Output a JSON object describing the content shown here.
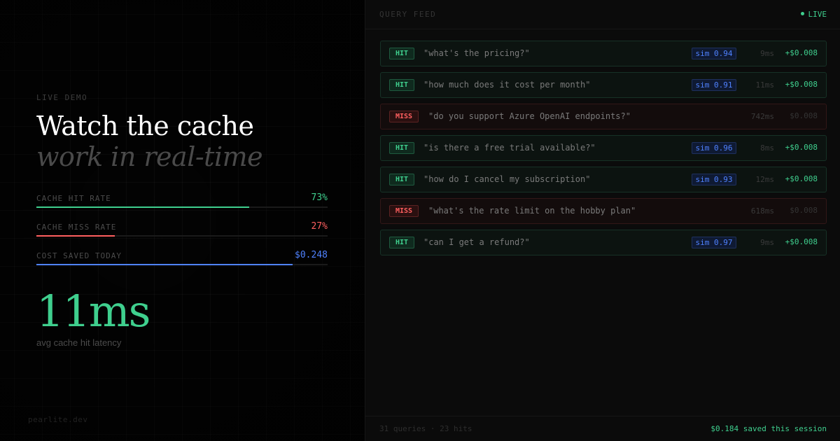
{
  "left": {
    "eyebrow": "LIVE DEMO",
    "title_line1": "Watch the cache",
    "title_line2": "work in real-time",
    "stats": [
      {
        "label": "CACHE HIT RATE",
        "value": "73%",
        "fraction": 0.73,
        "color": "#3fcf8e"
      },
      {
        "label": "CACHE MISS RATE",
        "value": "27%",
        "fraction": 0.27,
        "color": "#ff5f5f"
      },
      {
        "label": "COST SAVED TODAY",
        "value": "$0.248",
        "fraction": 0.88,
        "color": "#4f82ff"
      }
    ],
    "latency_value": "11ms",
    "latency_caption": "avg cache hit latency",
    "brand": "pearlite.dev"
  },
  "feed": {
    "title": "QUERY FEED",
    "live_label": "LIVE",
    "rows": [
      {
        "status": "HIT",
        "query": "\"what's the pricing?\"",
        "sim": "sim 0.94",
        "ms": "9ms",
        "saved": "+$0.008"
      },
      {
        "status": "HIT",
        "query": "\"how much does it cost per month\"",
        "sim": "sim 0.91",
        "ms": "11ms",
        "saved": "+$0.008"
      },
      {
        "status": "MISS",
        "query": "\"do you support Azure OpenAI endpoints?\"",
        "sim": "",
        "ms": "742ms",
        "saved": "$0.008"
      },
      {
        "status": "HIT",
        "query": "\"is there a free trial available?\"",
        "sim": "sim 0.96",
        "ms": "8ms",
        "saved": "+$0.008"
      },
      {
        "status": "HIT",
        "query": "\"how do I cancel my subscription\"",
        "sim": "sim 0.93",
        "ms": "12ms",
        "saved": "+$0.008"
      },
      {
        "status": "MISS",
        "query": "\"what's the rate limit on the hobby plan\"",
        "sim": "",
        "ms": "618ms",
        "saved": "$0.008"
      },
      {
        "status": "HIT",
        "query": "\"can I get a refund?\"",
        "sim": "sim 0.97",
        "ms": "9ms",
        "saved": "+$0.008"
      }
    ],
    "footer_counts": "31 queries · 23 hits",
    "footer_saved": "$0.184 saved this session"
  }
}
